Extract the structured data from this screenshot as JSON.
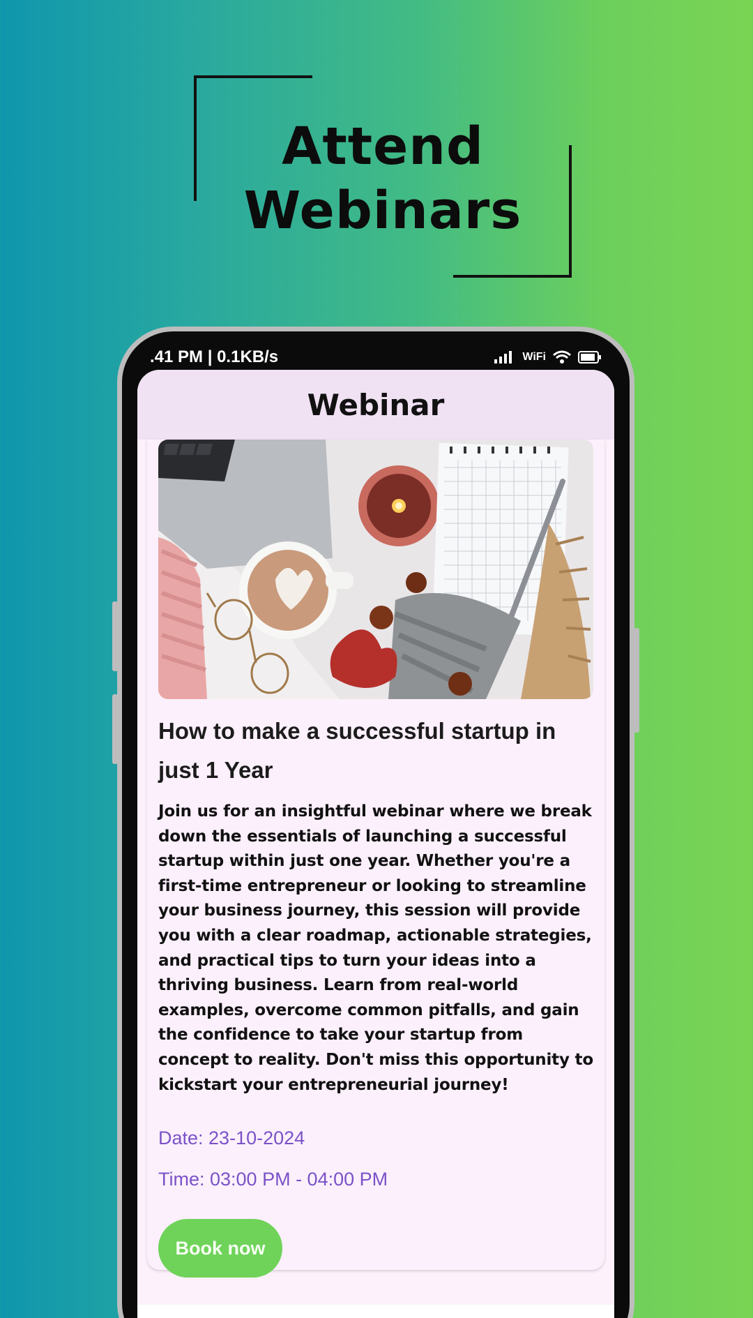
{
  "hero": {
    "title_line1": "Attend",
    "title_line2": "Webinars"
  },
  "status_bar": {
    "left": ".41 PM | 0.1KB/s",
    "network": "WiFi"
  },
  "header": {
    "title": "Webinar"
  },
  "webinar": {
    "title": "How to make a successful startup in just 1 Year",
    "description": "Join us for an insightful webinar where we break down the essentials of launching a successful startup within just one year. Whether you're a first-time entrepreneur or looking to streamline your business journey, this session will provide you with a clear roadmap, actionable strategies, and practical tips to turn your ideas into a thriving business. Learn from real-world examples, overcome common pitfalls, and gain the confidence to take your startup from concept to reality. Don't miss this opportunity to kickstart your entrepreneurial journey!",
    "date": "Date: 23-10-2024",
    "time": "Time: 03:00 PM - 04:00 PM",
    "book_label": "Book now"
  },
  "nav": {
    "items": [
      "home-icon",
      "analytics-icon",
      "add-document-icon",
      "dashboard-icon",
      "profile-icon"
    ],
    "active_color": "#6fd35a"
  },
  "colors": {
    "accent_purple": "#7a52c7",
    "button_green": "#6fd35a",
    "card_background": "#fcf0fc"
  }
}
